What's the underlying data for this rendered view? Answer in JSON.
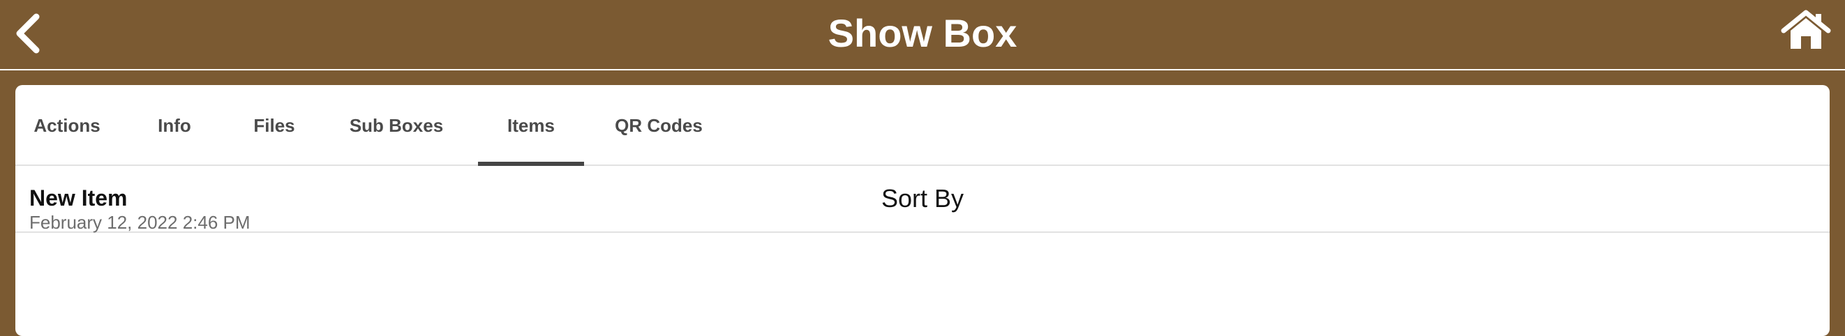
{
  "header": {
    "title": "Show Box",
    "back_icon": "chevron-left-icon",
    "home_icon": "home-icon",
    "background_color": "#7b5a32"
  },
  "tabs": [
    {
      "label": "Actions",
      "active": false
    },
    {
      "label": "Info",
      "active": false
    },
    {
      "label": "Files",
      "active": false
    },
    {
      "label": "Sub Boxes",
      "active": false
    },
    {
      "label": "Items",
      "active": true
    },
    {
      "label": "QR Codes",
      "active": false
    }
  ],
  "sort": {
    "label": "Sort By"
  },
  "items": [
    {
      "name": "New Item",
      "date": "February 12, 2022 2:46 PM"
    }
  ]
}
